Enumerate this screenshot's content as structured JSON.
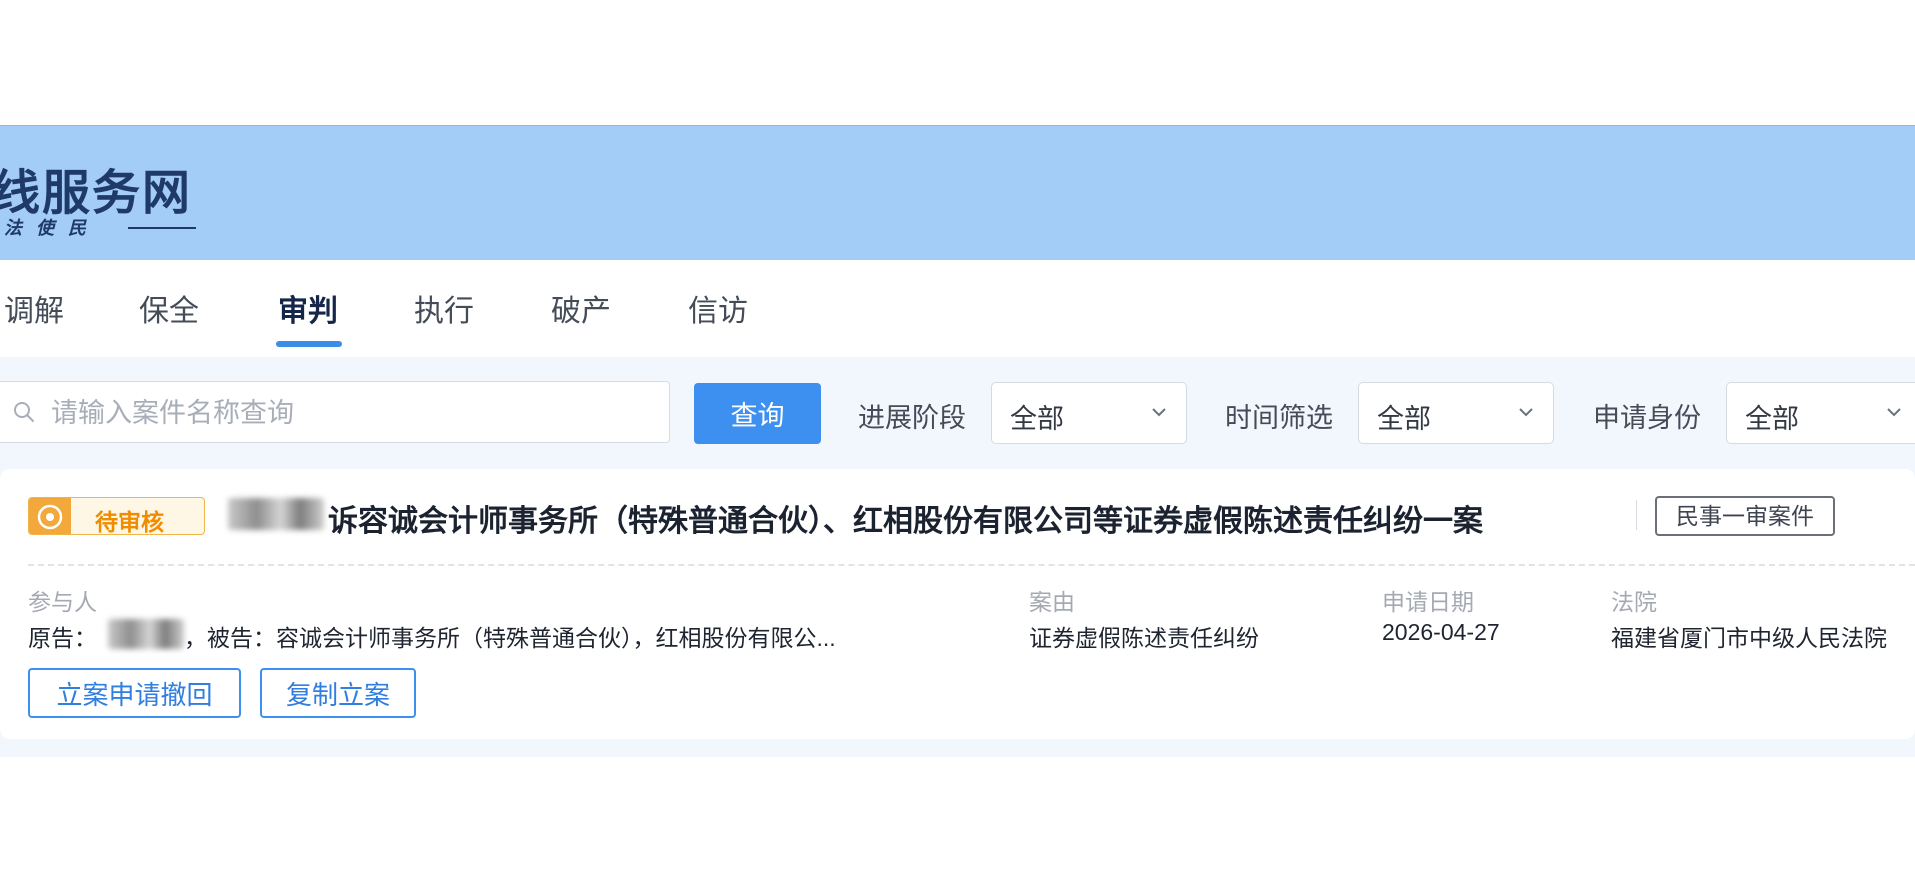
{
  "header": {
    "logo_title": "线服务网",
    "logo_subtitle": "法使民"
  },
  "nav": {
    "items": [
      {
        "label": "调解"
      },
      {
        "label": "保全"
      },
      {
        "label": "审判",
        "active": true
      },
      {
        "label": "执行"
      },
      {
        "label": "破产"
      },
      {
        "label": "信访"
      }
    ]
  },
  "search": {
    "placeholder": "请输入案件名称查询",
    "value": "",
    "button_label": "查询"
  },
  "filters": [
    {
      "label": "进展阶段",
      "selected": "全部"
    },
    {
      "label": "时间筛选",
      "selected": "全部"
    },
    {
      "label": "申请身份",
      "selected": "全部"
    }
  ],
  "case_card": {
    "status": "待审核",
    "title": "诉容诚会计师事务所（特殊普通合伙）、红相股份有限公司等证券虚假陈述责任纠纷一案",
    "case_type": "民事一审案件",
    "fields": {
      "participants_label": "参与人",
      "plaintiff_prefix": "原告：",
      "defendant_text": "，被告：容诚会计师事务所（特殊普通合伙），红相股份有限公...",
      "cause_label": "案由",
      "cause_value": "证券虚假陈述责任纠纷",
      "date_label": "申请日期",
      "date_value": "2026-04-27",
      "court_label": "法院",
      "court_value": "福建省厦门市中级人民法院"
    },
    "actions": {
      "withdraw_label": "立案申请撤回",
      "copy_label": "复制立案"
    }
  },
  "colors": {
    "banner": "#a3cdf7",
    "accent": "#3d8ff0",
    "status_orange": "#f08c00",
    "content_bg": "#f2f7fe"
  }
}
